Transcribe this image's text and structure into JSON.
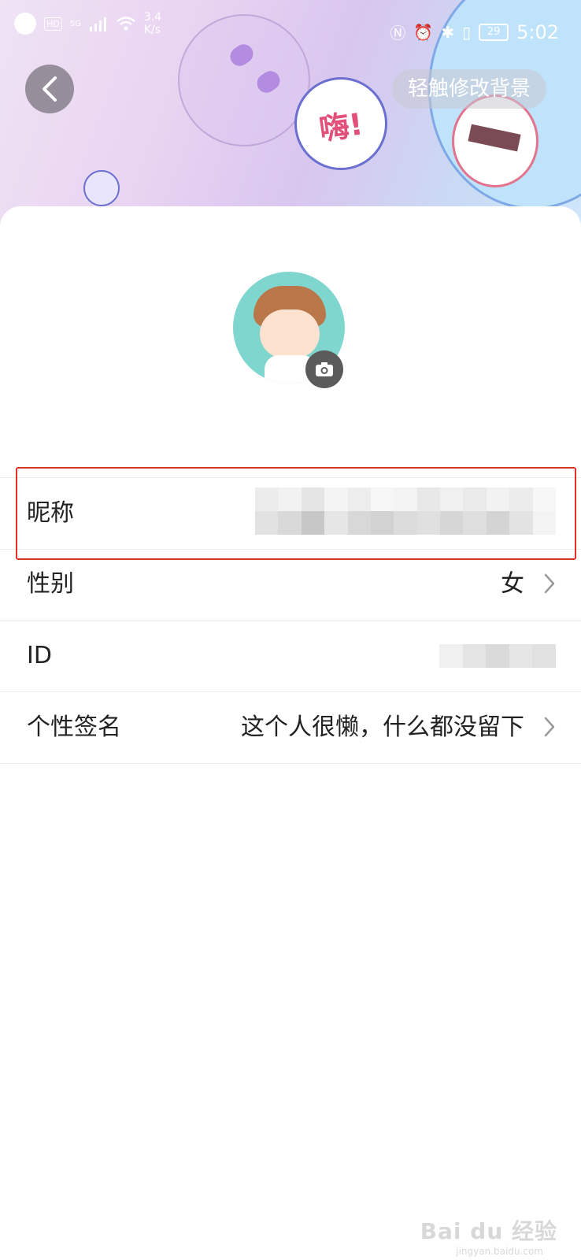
{
  "status_bar": {
    "network_hd": "HD",
    "network_5g": "5G",
    "speed_value": "3.4",
    "speed_unit": "K/s",
    "battery": "29",
    "time": "5:02"
  },
  "header": {
    "change_background_label": "轻触修改背景",
    "bubble_text": "嗨!"
  },
  "profile": {
    "rows": [
      {
        "label": "昵称",
        "value": ""
      },
      {
        "label": "性别",
        "value": "女"
      },
      {
        "label": "ID",
        "value": ""
      },
      {
        "label": "个性签名",
        "value": "这个人很懒，什么都没留下"
      }
    ]
  },
  "watermark": {
    "brand": "Bai du 经验",
    "url": "jingyan.baidu.com"
  },
  "colors": {
    "highlight": "#e0302a",
    "avatar_bg": "#7fd6cf"
  }
}
